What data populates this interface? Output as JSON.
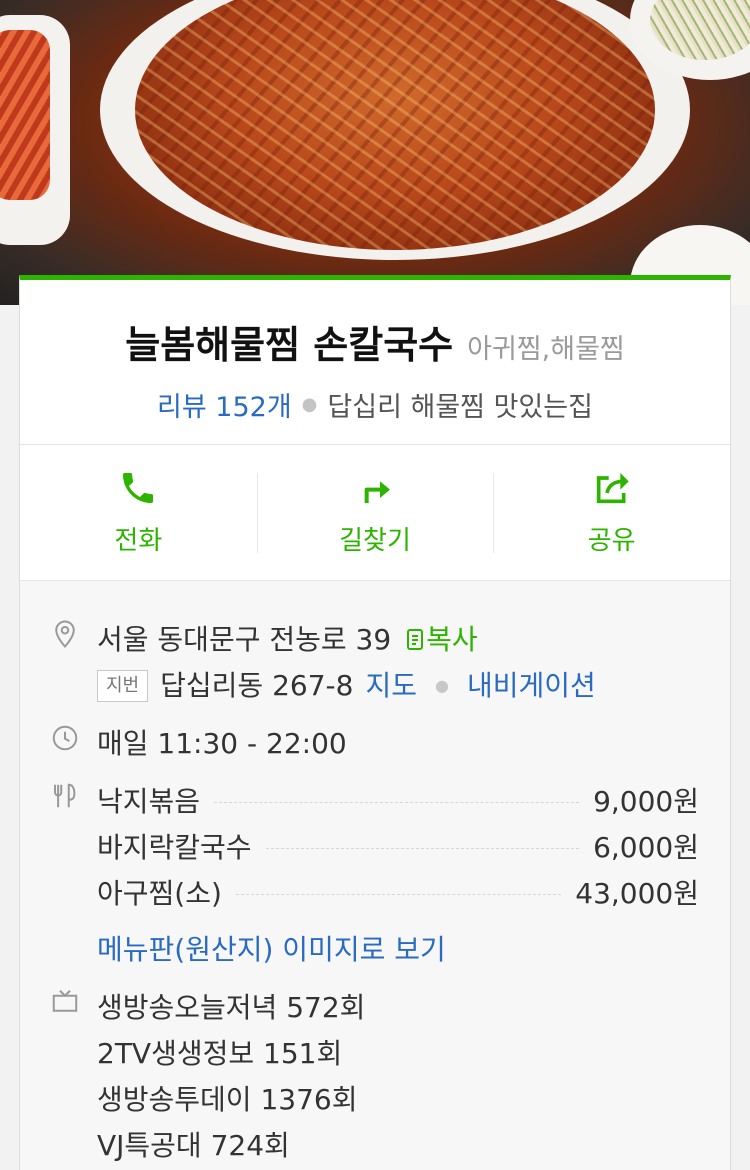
{
  "header": {
    "title": "늘봄해물찜 손칼국수",
    "category": "아귀찜,해물찜",
    "review_label": "리뷰 152개",
    "tagline": "답십리 해물찜 맛있는집"
  },
  "actions": [
    {
      "label": "전화",
      "icon": "phone-icon"
    },
    {
      "label": "길찾기",
      "icon": "directions-icon"
    },
    {
      "label": "공유",
      "icon": "share-icon"
    }
  ],
  "address": {
    "road": "서울 동대문구 전농로 39",
    "copy_label": "복사",
    "jibun_badge": "지번",
    "jibun": "답십리동 267-8",
    "map_link": "지도",
    "navigation_link": "내비게이션"
  },
  "hours": "매일 11:30 - 22:00",
  "menu": {
    "items": [
      {
        "name": "낙지볶음",
        "price": "9,000원"
      },
      {
        "name": "바지락칼국수",
        "price": "6,000원"
      },
      {
        "name": "아구찜(소)",
        "price": "43,000원"
      }
    ],
    "image_link": "메뉴판(원산지) 이미지로 보기"
  },
  "tv": [
    "생방송오늘저녁 572회",
    "2TV생생정보 151회",
    "생방송투데이 1376회",
    "VJ특공대 724회"
  ],
  "colors": {
    "accent_green": "#2db400",
    "link_blue": "#2a6bc1"
  }
}
